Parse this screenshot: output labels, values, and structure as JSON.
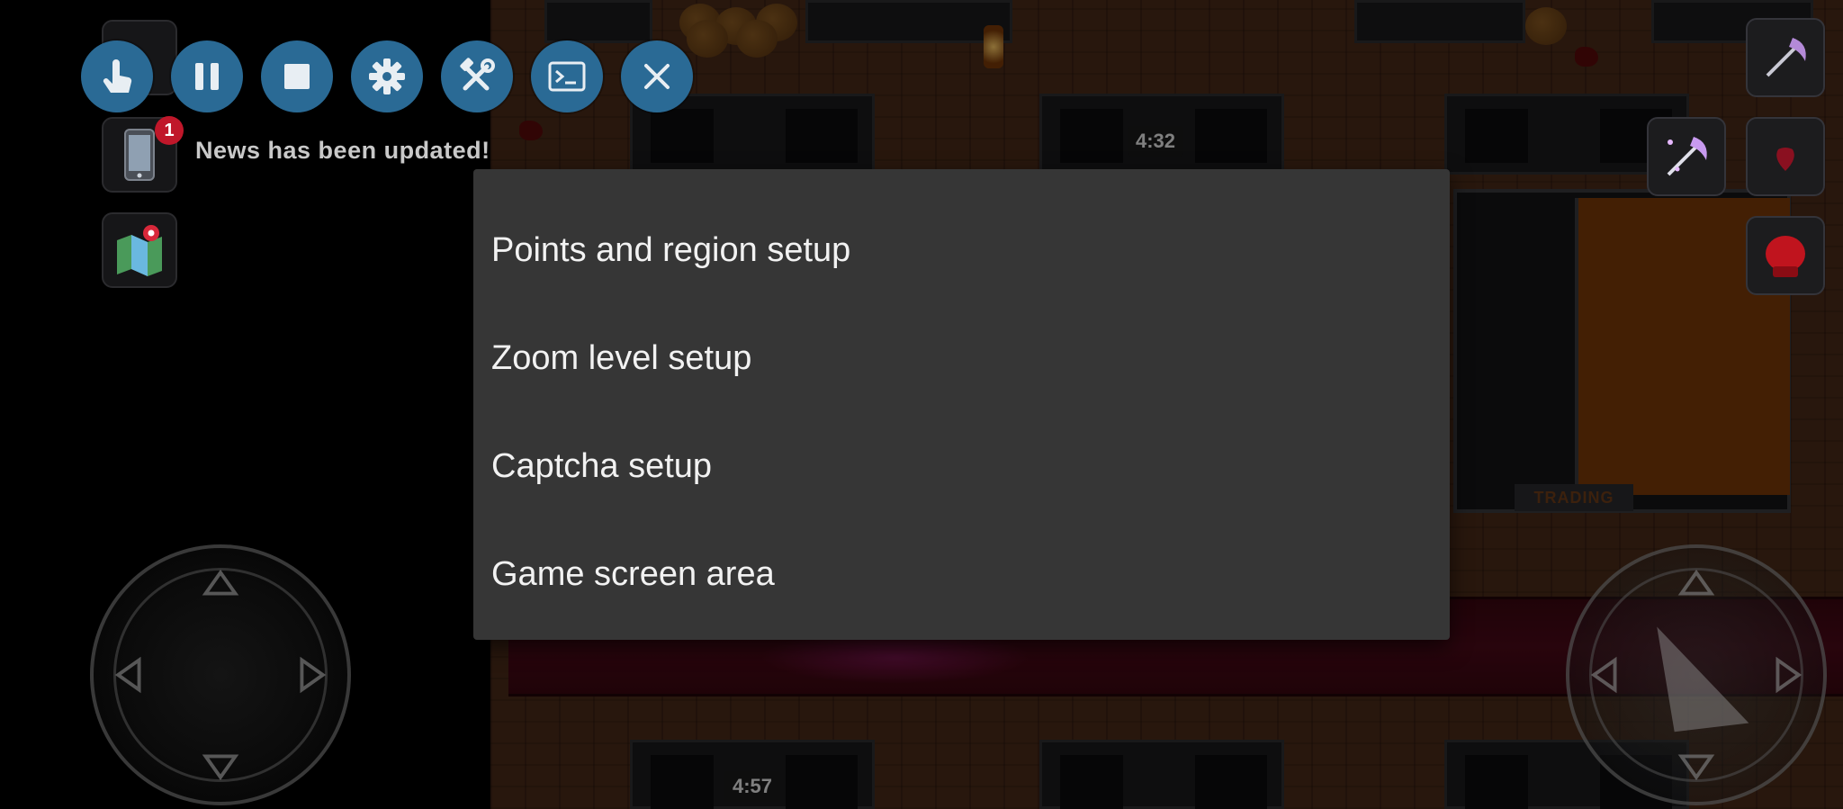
{
  "toolbar": {
    "buttons": [
      {
        "name": "touch-mode-button",
        "icon": "hand-tap-icon"
      },
      {
        "name": "pause-button",
        "icon": "pause-icon"
      },
      {
        "name": "stop-button",
        "icon": "stop-icon"
      },
      {
        "name": "settings-button",
        "icon": "gear-icon"
      },
      {
        "name": "tools-button",
        "icon": "hammer-wrench-icon"
      },
      {
        "name": "console-button",
        "icon": "terminal-icon"
      },
      {
        "name": "close-button",
        "icon": "close-icon"
      }
    ],
    "accent_color": "#2a6a95"
  },
  "hud": {
    "news_badge_count": "1",
    "news_text": "News has been updated!"
  },
  "game": {
    "timer_top": "4:32",
    "timer_bottom": "4:57",
    "shop_label": "TRADING"
  },
  "menu": {
    "items": [
      "Points and region setup",
      "Zoom level setup",
      "Captcha setup",
      "Game screen area"
    ]
  }
}
